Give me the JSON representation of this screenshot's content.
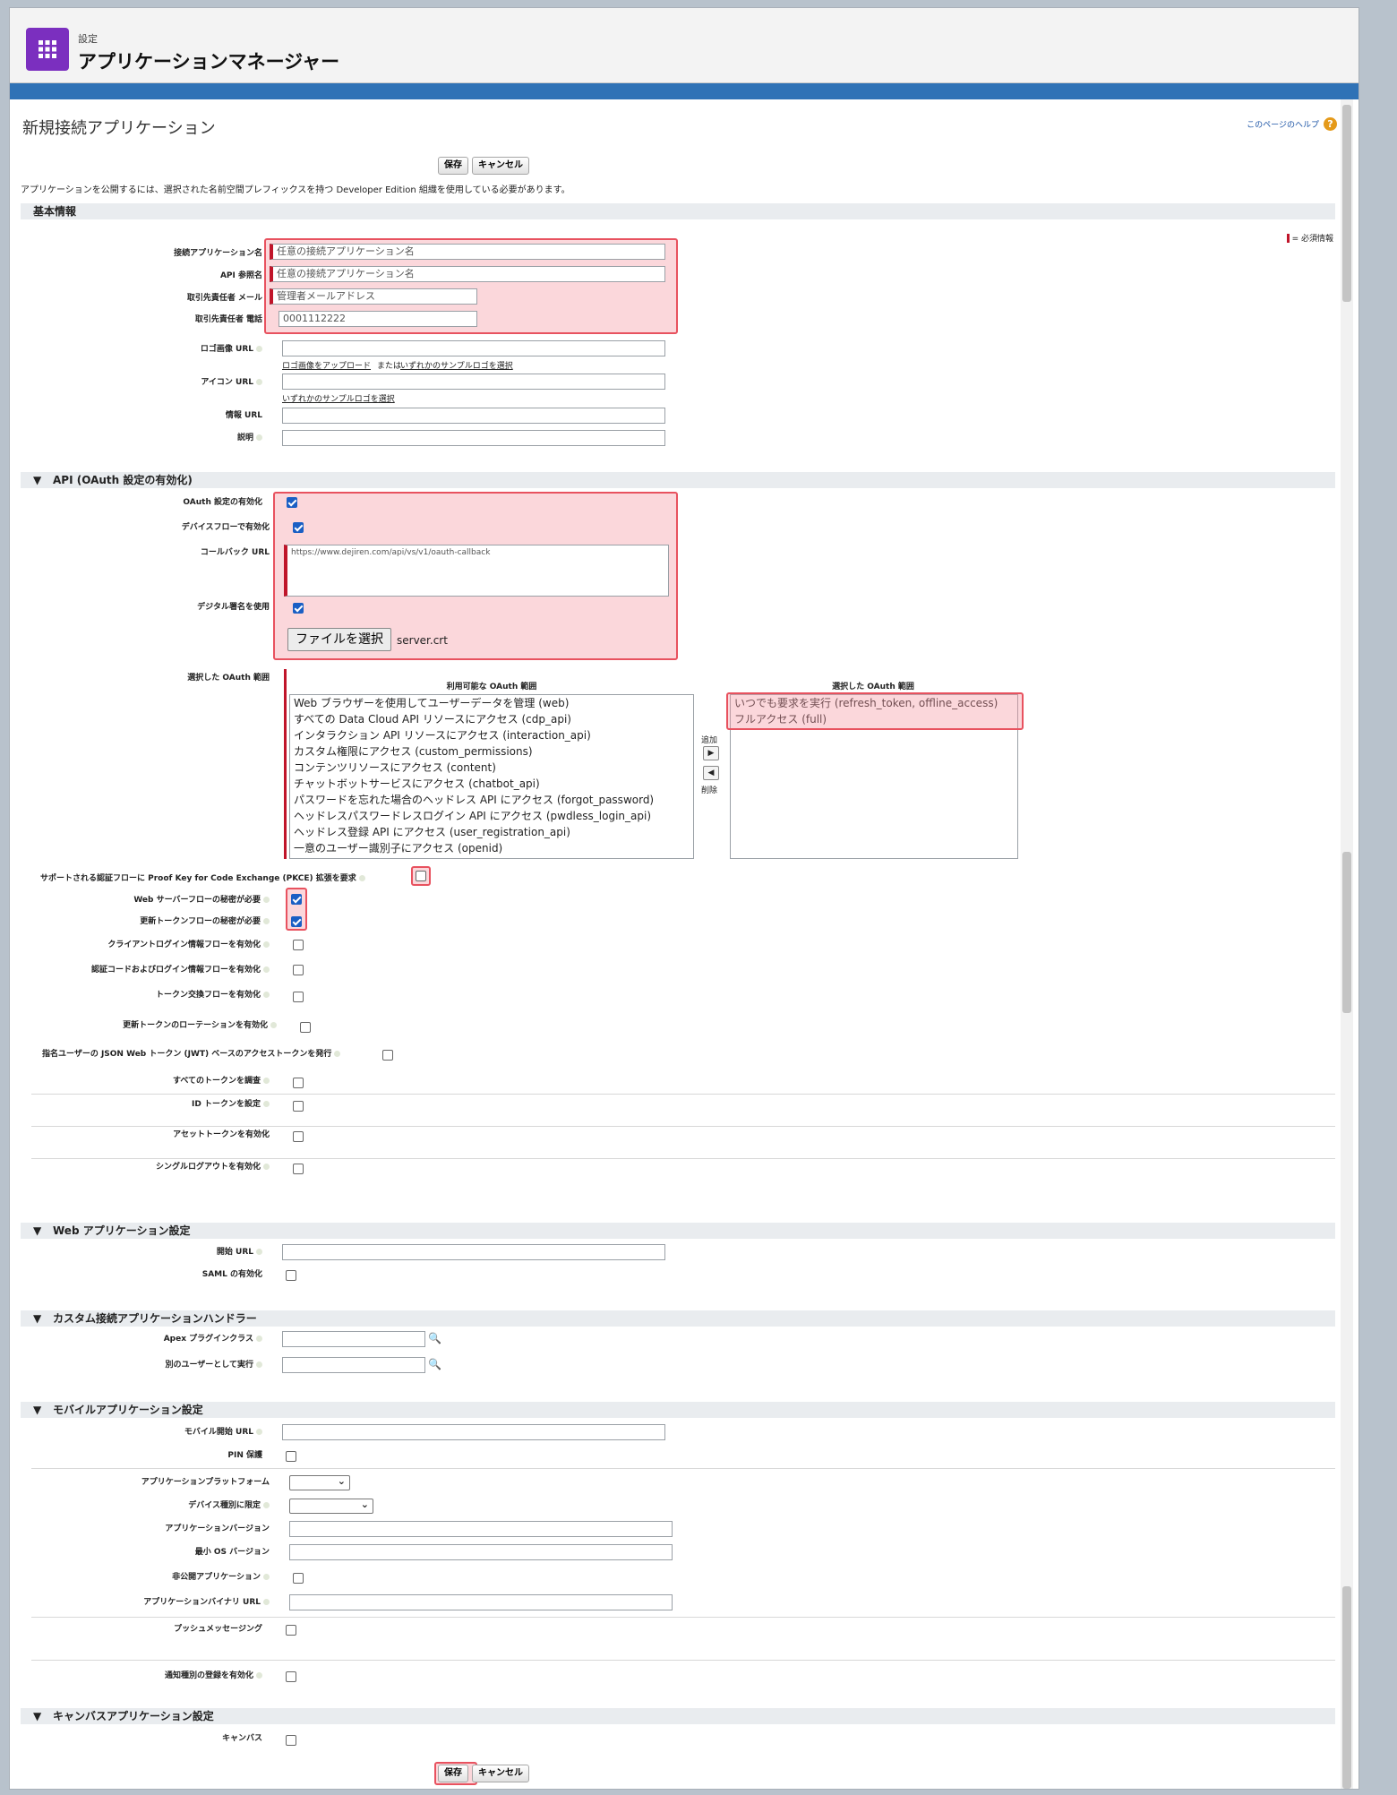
{
  "header": {
    "breadcrumb": "設定",
    "title": "アプリケーションマネージャー"
  },
  "page": {
    "title": "新規接続アプリケーション",
    "help_link": "このページのヘルプ",
    "help_icon": "?",
    "save": "保存",
    "cancel": "キャンセル",
    "note": "アプリケーションを公開するには、選択された名前空間プレフィックスを持つ Developer Edition 組織を使用している必要があります。",
    "required_legend": "= 必須情報"
  },
  "basic": {
    "section": "基本情報",
    "app_name_label": "接続アプリケーション名",
    "app_name_value": "任意の接続アプリケーション名",
    "api_name_label": "API 参照名",
    "api_name_value": "任意の接続アプリケーション名",
    "email_label": "取引先責任者 メール",
    "email_value": "管理者メールアドレス",
    "phone_label": "取引先責任者 電話",
    "phone_value": "0001112222",
    "logo_label": "ロゴ画像 URL",
    "logo_link_upload": "ロゴ画像をアップロード",
    "logo_or": "または",
    "logo_link_sample": "いずれかのサンプルロゴを選択",
    "icon_label": "アイコン URL",
    "icon_link_sample": "いずれかのサンプルロゴを選択",
    "info_label": "情報 URL",
    "desc_label": "説明"
  },
  "api": {
    "section": "API (OAuth 設定の有効化)",
    "oauth_enable": "OAuth 設定の有効化",
    "device_flow": "デバイスフローで有効化",
    "callback_label": "コールバック URL",
    "callback_value": "https://www.dejiren.com/api/vs/v1/oauth-callback",
    "digital_sig": "デジタル署名を使用",
    "file_button": "ファイルを選択",
    "file_name": "server.crt",
    "scopes_label": "選択した OAuth 範囲",
    "available_header": "利用可能な OAuth 範囲",
    "selected_header": "選択した OAuth 範囲",
    "available": [
      "Web ブラウザーを使用してユーザーデータを管理 (web)",
      "すべての Data Cloud API リソースにアクセス (cdp_api)",
      "インタラクション API リソースにアクセス (interaction_api)",
      "カスタム権限にアクセス (custom_permissions)",
      "コンテンツリソースにアクセス (content)",
      "チャットボットサービスにアクセス (chatbot_api)",
      "パスワードを忘れた場合のヘッドレス API にアクセス (forgot_password)",
      "ヘッドレスパスワードレスログイン API にアクセス (pwdless_login_api)",
      "ヘッドレス登録 API にアクセス (user_registration_api)",
      "一意のユーザー識別子にアクセス (openid)"
    ],
    "selected": [
      "いつでも要求を実行 (refresh_token, offline_access)",
      "フルアクセス (full)"
    ],
    "add": "追加",
    "remove": "削除",
    "pkce": "サポートされる認証フローに Proof Key for Code Exchange (PKCE) 拡張を要求",
    "web_secret": "Web サーバーフローの秘密が必要",
    "refresh_secret": "更新トークンフローの秘密が必要",
    "client_cred": "クライアントログイン情報フローを有効化",
    "auth_code_cred": "認証コードおよびログイン情報フローを有効化",
    "token_exchange": "トークン交換フローを有効化",
    "refresh_rotation": "更新トークンのローテーションを有効化",
    "jwt": "指名ユーザーの JSON Web トークン (JWT) ベースのアクセストークンを発行",
    "introspect": "すべてのトークンを調査",
    "id_token": "ID トークンを設定",
    "asset_token": "アセットトークンを有効化",
    "single_logout": "シングルログアウトを有効化"
  },
  "webapp": {
    "section": "Web アプリケーション設定",
    "start_url": "開始 URL",
    "saml": "SAML の有効化"
  },
  "handler": {
    "section": "カスタム接続アプリケーションハンドラー",
    "apex": "Apex プラグインクラス",
    "run_as": "別のユーザーとして実行"
  },
  "mobile": {
    "section": "モバイルアプリケーション設定",
    "start_url": "モバイル開始 URL",
    "pin": "PIN 保護",
    "platform": "アプリケーションプラットフォーム",
    "device_type": "デバイス種別に限定",
    "app_version": "アプリケーションバージョン",
    "min_os": "最小 OS バージョン",
    "private_app": "非公開アプリケーション",
    "binary_url": "アプリケーションバイナリ URL",
    "push": "プッシュメッセージング",
    "notif": "通知種別の登録を有効化"
  },
  "canvas": {
    "section": "キャンバスアプリケーション設定",
    "canvas": "キャンバス"
  },
  "colors": {
    "accent": "#7b2fbf",
    "band": "#2f72b6",
    "required": "#c0152a",
    "highlight": "#e8525f"
  }
}
